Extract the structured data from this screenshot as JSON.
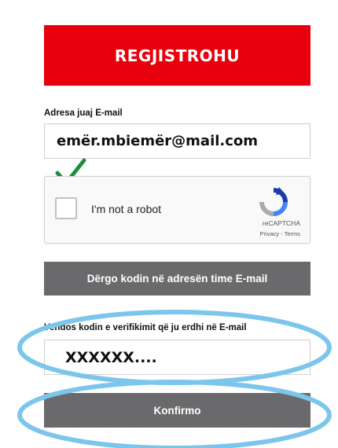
{
  "register": {
    "title": "REGJISTROHU"
  },
  "email": {
    "label": "Adresa juaj E-mail",
    "value": "emër.mbiemër@mail.com"
  },
  "captcha": {
    "label": "I'm not a robot",
    "brand": "reCAPTCHA",
    "privacy": "Privacy",
    "separator": " - ",
    "terms": "Terms",
    "checked": false
  },
  "send_code": {
    "label": "Dërgo kodin në adresën time E-mail"
  },
  "verification": {
    "label": "Vendos kodin e verifikimit që ju erdhi në E-mail",
    "placeholder": "XXXXXX...."
  },
  "confirm": {
    "label": "Konfirmo"
  },
  "colors": {
    "brand_red": "#e8000d",
    "button_gray": "#6a6a6c",
    "check_green": "#1e8e3e",
    "highlight_blue": "#7cc6ec"
  },
  "icons": {
    "check": "check-mark-icon",
    "recaptcha": "recaptcha-logo-icon"
  }
}
